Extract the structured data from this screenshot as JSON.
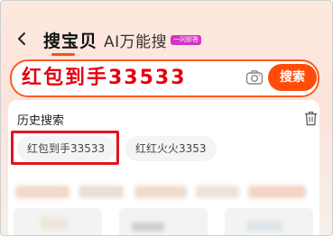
{
  "nav": {
    "back_icon": "chevron-left-icon",
    "tabs": [
      {
        "label": "搜宝贝",
        "active": true
      },
      {
        "label": "AI万能搜",
        "active": false
      }
    ],
    "ai_badge": "一问即答",
    "accent": "#ff4c1a"
  },
  "search": {
    "value": "红包到手33533",
    "camera_icon": "camera-icon",
    "button_label": "搜索",
    "button_color": "#ff4c0a",
    "value_color": "#e60012"
  },
  "history": {
    "title": "历史搜索",
    "trash_icon": "trash-icon",
    "items": [
      {
        "label": "红包到手33533",
        "highlighted": true
      },
      {
        "label": "红红火火3353",
        "highlighted": false
      }
    ],
    "highlight_color": "#e3141c"
  }
}
